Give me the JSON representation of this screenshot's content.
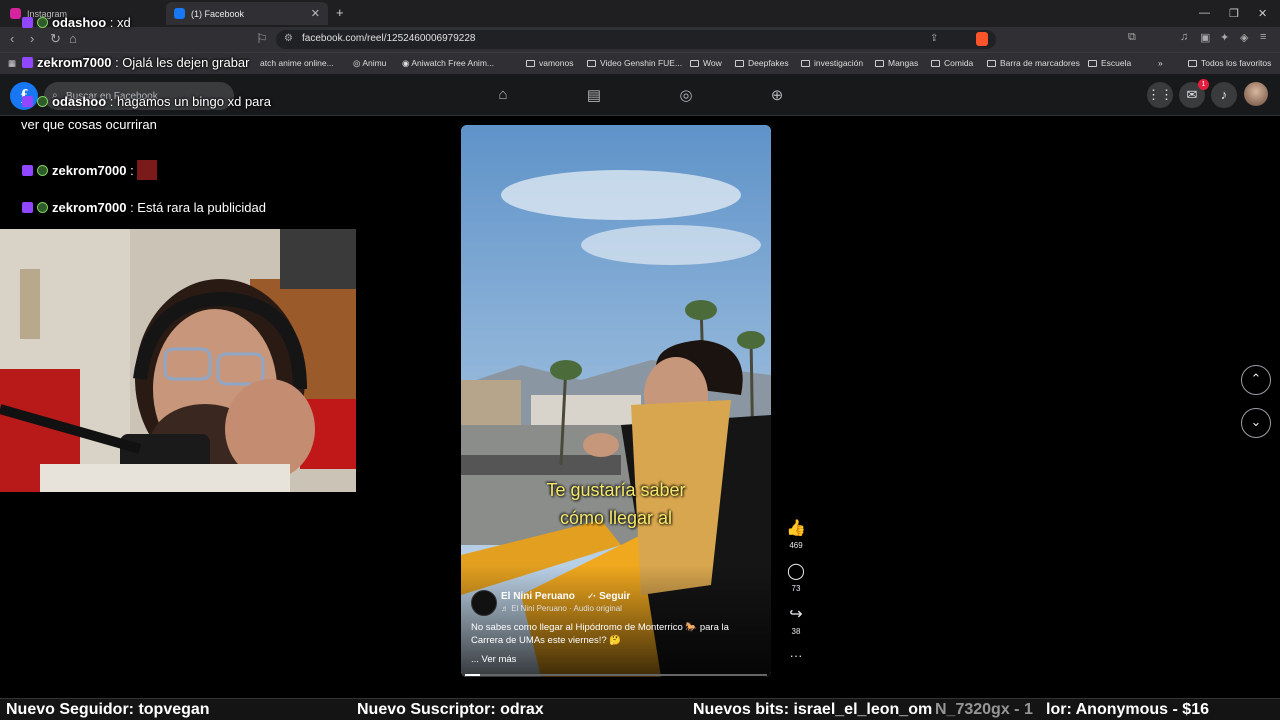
{
  "browser": {
    "tabs": [
      {
        "label": "Instagram",
        "favicon_color": "#d6249f"
      },
      {
        "label": "(1) Facebook",
        "favicon_color": "#1877f2"
      }
    ],
    "url": "facebook.com/reel/1252460006979228",
    "bookmarks": [
      "Animu",
      "Aniwatch Free Anim...",
      "vamonos",
      "Video Genshin FUE...",
      "Wow",
      "Deepfakes",
      "investigación",
      "Mangas",
      "Comida",
      "Barra de marcadores",
      "Escuela"
    ],
    "partial_bookmark": "atch anime online...",
    "all_bookmarks": "Todos los favoritos"
  },
  "facebook": {
    "logo": "f",
    "search_placeholder": "Buscar en Facebook",
    "notification_count": "1"
  },
  "chat": [
    {
      "user": "odashoo",
      "message": ": xd"
    },
    {
      "user": "zekrom7000",
      "message": ": Ojalá les dejen grabar"
    },
    {
      "user": "odashoo",
      "message": ": hagamos un bingo xd para"
    },
    {
      "continuation": "ver que cosas ocurriran"
    },
    {
      "user": "zekrom7000",
      "message": ":"
    },
    {
      "user": "zekrom7000",
      "message": ": Está rara la publicidad"
    }
  ],
  "reel": {
    "subtitle_line1": "Te gustaría saber",
    "subtitle_line2": "cómo llegar al",
    "author": "El Nini Peruano",
    "follow": "· Seguir",
    "audio": "♬ El Nini Peruano · Audio original",
    "caption_line1": "No sabes como llegar al Hipódromo de Monterrico 🐎 para la",
    "caption_line2": "Carrera de UMAs este viernes!? 🤔",
    "see_more": "... Ver más",
    "likes": "469",
    "comments": "73",
    "shares": "38"
  },
  "ticker": {
    "follower": "Nuevo Seguidor: topvegan",
    "subscriber": "Nuevo Suscriptor: odrax",
    "bits": "Nuevos bits: israel_el_leon_om",
    "bits_overlap": "N_7320gx - 1",
    "donor": "lor: Anonymous - $16"
  },
  "colors": {
    "twitch": "#9146ff",
    "facebook_blue": "#1877f2",
    "subtitle": "#f4e96a"
  }
}
